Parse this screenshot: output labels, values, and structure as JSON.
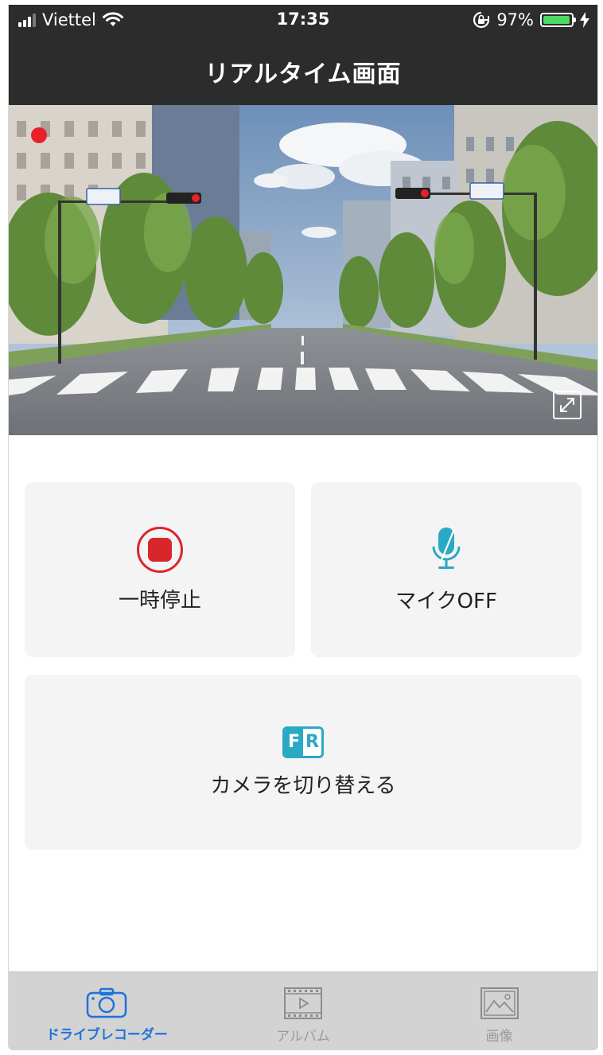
{
  "status": {
    "carrier": "Viettel",
    "time": "17:35",
    "battery": "97%",
    "battery_level": 0.97
  },
  "header": {
    "title": "リアルタイム画面"
  },
  "controls": {
    "pause_label": "一時停止",
    "mic_label": "マイクOFF",
    "switch_label": "カメラを切り替える",
    "fr_front": "F",
    "fr_rear": "R"
  },
  "tabs": [
    {
      "label": "ドライブレコーダー",
      "icon": "camera-icon",
      "active": true
    },
    {
      "label": "アルバム",
      "icon": "film-play-icon",
      "active": false
    },
    {
      "label": "画像",
      "icon": "image-icon",
      "active": false
    }
  ],
  "colors": {
    "header_bg": "#2c2c2c",
    "record_red": "#d9262c",
    "mic_blue": "#2aa9c4",
    "active_tab": "#1e73d9",
    "battery_green": "#4cd964"
  }
}
